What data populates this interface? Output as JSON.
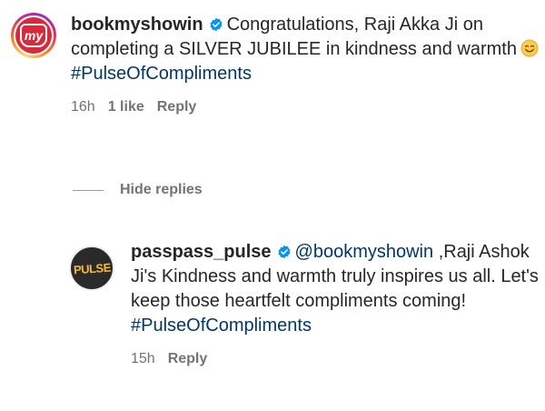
{
  "comment1": {
    "avatar_text": "my",
    "username": "bookmyshowin",
    "text": "Congratulations, Raji Akka Ji on completing a SILVER JUBILEE in kindness and warmth",
    "hashtag": "#PulseOfCompliments",
    "time": "16h",
    "likes": "1 like",
    "reply": "Reply"
  },
  "hide_replies": "Hide replies",
  "comment2": {
    "avatar_text": "PULSE",
    "username": "passpass_pulse",
    "mention": "@bookmyshowin",
    "text": ",Raji Ashok Ji's Kindness and warmth truly inspires us all. Let's keep those heartfelt compliments coming!",
    "hashtag": "#PulseOfCompliments",
    "time": "15h",
    "reply": "Reply"
  },
  "colors": {
    "verified": "#0095f6",
    "link": "#00376b",
    "meta": "#737373",
    "bms_red": "#d62b3c"
  }
}
